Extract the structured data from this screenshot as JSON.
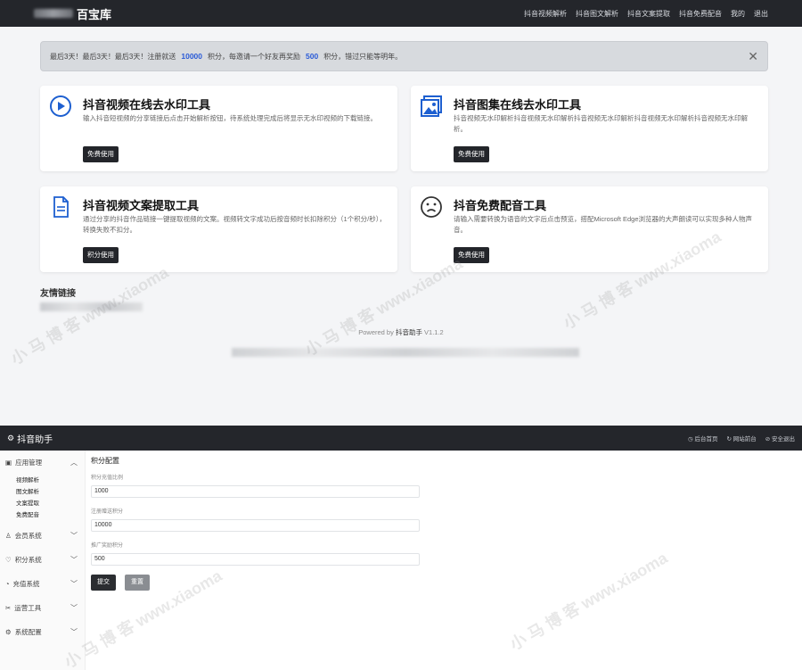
{
  "site": {
    "brand_suffix": "百宝库",
    "nav": [
      "抖音视频解析",
      "抖音图文解析",
      "抖音文案提取",
      "抖音免费配音",
      "我的",
      "退出"
    ]
  },
  "alert": {
    "text_before": "最后3天！最后3天！最后3天！注册就送",
    "points_register": "10000",
    "text_mid": "积分，每邀请一个好友再奖励",
    "points_invite": "500",
    "text_after": "积分，错过只能等明年。",
    "close_symbol": "✕"
  },
  "cards": [
    {
      "icon": "play-circle-icon",
      "title": "抖音视频在线去水印工具",
      "desc": "输入抖音短视频的分享链接后点击开始解析按钮，待系统处理完成后将显示无水印视频的下载链接。",
      "button": "免费使用"
    },
    {
      "icon": "image-gallery-icon",
      "title": "抖音图集在线去水印工具",
      "desc": "抖音视频无水印解析抖音视频无水印解析抖音视频无水印解析抖音视频无水印解析抖音视频无水印解析。",
      "button": "免费使用"
    },
    {
      "icon": "document-icon",
      "title": "抖音视频文案提取工具",
      "desc": "通过分享的抖音作品链接一键提取视频的文案。视频转文字成功后按音频时长扣除积分（1个积分/秒），转换失败不扣分。",
      "button": "积分使用"
    },
    {
      "icon": "sad-face-icon",
      "title": "抖音免费配音工具",
      "desc": "请输入需要转换为语音的文字后点击预览，搭配Microsoft Edge浏览器的大声朗读可以实现多种人物声音。",
      "button": "免费使用"
    }
  ],
  "friends_title": "友情链接",
  "powered": {
    "prefix": "Powered by",
    "name": "抖音助手",
    "version": "V1.1.2"
  },
  "admin": {
    "brand": "抖音助手",
    "top_links": [
      "后台首页",
      "网站前台",
      "安全退出"
    ],
    "sidebar": {
      "app_group": "应用管理",
      "app_items": [
        "视频解析",
        "图文解析",
        "文案提取",
        "免费配音"
      ],
      "groups": [
        "会员系统",
        "积分系统",
        "充值系统",
        "运营工具",
        "系统配置"
      ]
    },
    "form": {
      "title": "积分配置",
      "fields": [
        {
          "label": "积分充值比例",
          "value": "1000"
        },
        {
          "label": "注册赠送积分",
          "value": "10000"
        },
        {
          "label": "推广奖励积分",
          "value": "500"
        }
      ],
      "submit": "提交",
      "reset": "重置"
    }
  }
}
